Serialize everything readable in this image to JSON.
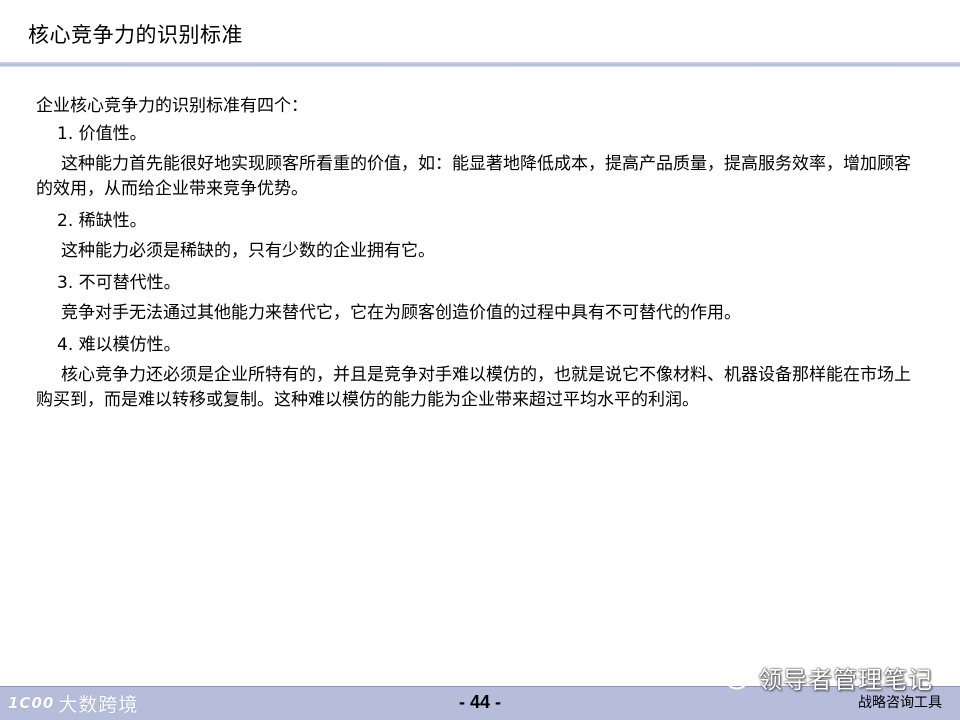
{
  "slide": {
    "title": "核心竞争力的识别标准",
    "intro": "企业核心竞争力的识别标准有四个：",
    "criteria": [
      {
        "heading": "1. 价值性。",
        "description": "这种能力首先能很好地实现顾客所看重的价值，如：能显著地降低成本，提高产品质量，提高服务效率，增加顾客的效用，从而给企业带来竞争优势。"
      },
      {
        "heading": "2. 稀缺性。",
        "description": "这种能力必须是稀缺的，只有少数的企业拥有它。"
      },
      {
        "heading": "3. 不可替代性。",
        "description": "竞争对手无法通过其他能力来替代它，它在为顾客创造价值的过程中具有不可替代的作用。"
      },
      {
        "heading": "4. 难以模仿性。",
        "description": "核心竞争力还必须是企业所特有的，并且是竞争对手难以模仿的，也就是说它不像材料、机器设备那样能在市场上购买到，而是难以转移或复制。这种难以模仿的能力能为企业带来超过平均水平的利润。"
      }
    ]
  },
  "footer": {
    "logo_mark": "1C00",
    "logo_text": "大数跨境",
    "page_number": "- 44 -",
    "label": "战略咨询工具"
  },
  "watermark": {
    "text": "领导者管理笔记",
    "icon": "wechat-icon"
  }
}
